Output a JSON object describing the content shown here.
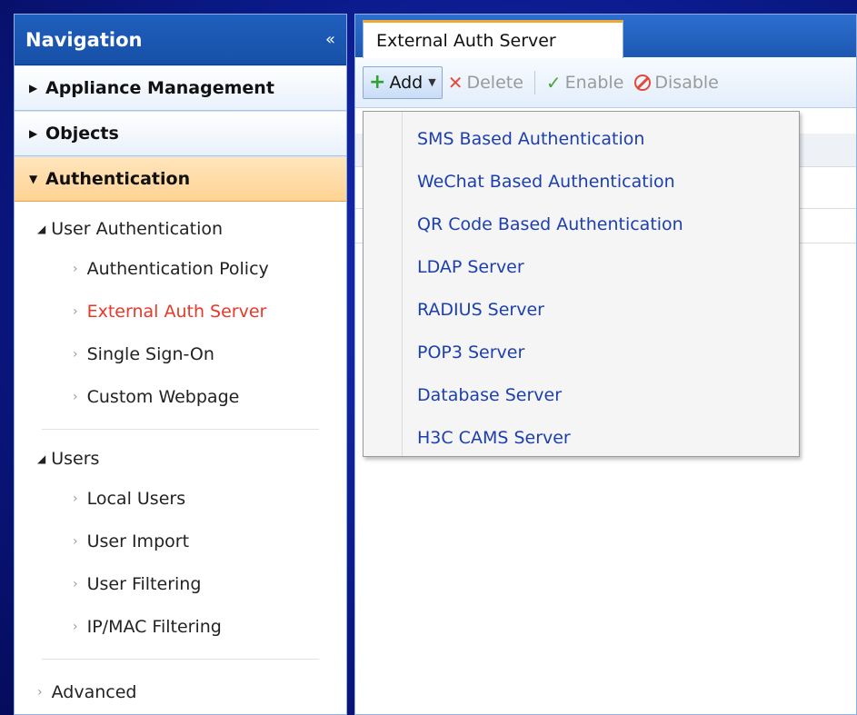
{
  "sidebar": {
    "title": "Navigation",
    "collapse_glyph": "«",
    "sections": [
      {
        "label": "Appliance Management",
        "expanded": false
      },
      {
        "label": "Objects",
        "expanded": false
      },
      {
        "label": "Authentication",
        "expanded": true
      }
    ],
    "groups": [
      {
        "label": "User Authentication",
        "items": [
          "Authentication Policy",
          "External Auth Server",
          "Single Sign-On",
          "Custom Webpage"
        ]
      },
      {
        "label": "Users",
        "items": [
          "Local Users",
          "User Import",
          "User Filtering",
          "IP/MAC Filtering"
        ]
      }
    ],
    "advanced_label": "Advanced",
    "current_item": "External Auth Server"
  },
  "tabs": [
    {
      "label": "External Auth Server",
      "active": true
    }
  ],
  "toolbar": {
    "add_label": "Add",
    "delete_label": "Delete",
    "enable_label": "Enable",
    "disable_label": "Disable"
  },
  "add_menu": {
    "items": [
      "SMS Based Authentication",
      "WeChat Based Authentication",
      "QR Code Based Authentication",
      "LDAP Server",
      "RADIUS Server",
      "POP3 Server",
      "Database Server",
      "H3C CAMS Server"
    ]
  },
  "colors": {
    "accent_blue": "#1f5fbd",
    "active_section": "#ffd393",
    "current_item": "#e8382a",
    "menu_text": "#1c3fae"
  }
}
